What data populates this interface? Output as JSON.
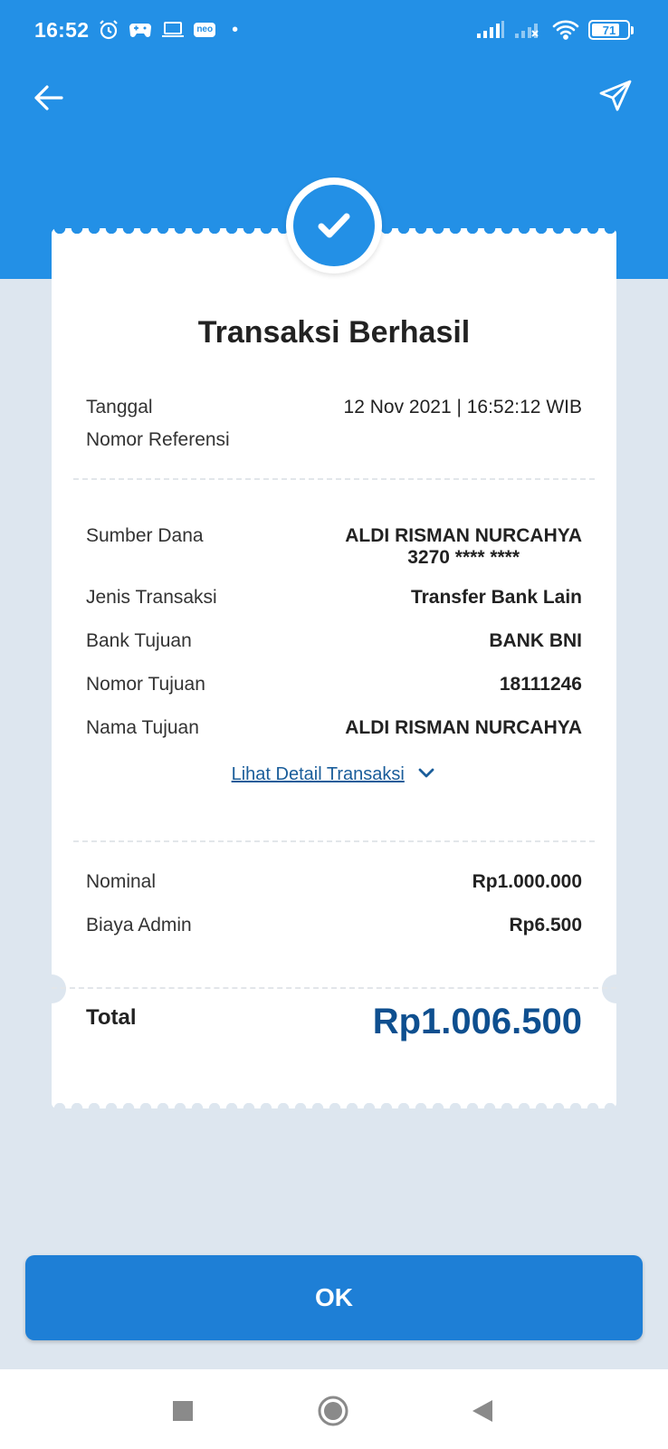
{
  "status_bar": {
    "time": "16:52",
    "neo_label": "neo",
    "battery": "71",
    "battery_level": 0.71,
    "icons": [
      "alarm-icon",
      "game-icon",
      "laptop-icon",
      "neo-icon",
      "signal-icon",
      "signal-x-icon",
      "wifi-icon",
      "battery-icon"
    ]
  },
  "header": {
    "back_icon": "arrow-left-icon",
    "share_icon": "send-icon"
  },
  "receipt": {
    "status_icon": "checkmark-icon",
    "title": "Transaksi Berhasil",
    "date_label": "Tanggal",
    "date_value": "12 Nov 2021 | 16:52:12 WIB",
    "reference_label": "Nomor Referensi",
    "reference_value": "",
    "source_label": "Sumber Dana",
    "source_name": "ALDI RISMAN NURCAHYA",
    "source_account": "3270 **** ****",
    "type_label": "Jenis Transaksi",
    "type_value": "Transfer Bank Lain",
    "bank_label": "Bank Tujuan",
    "bank_value": "BANK BNI",
    "dest_number_label": "Nomor Tujuan",
    "dest_number_value": "18111246",
    "dest_name_label": "Nama Tujuan",
    "dest_name_value": "ALDI RISMAN NURCAHYA",
    "detail_link": "Lihat Detail Transaksi",
    "nominal_label": "Nominal",
    "nominal_value": "Rp1.000.000",
    "admin_label": "Biaya Admin",
    "admin_value": "Rp6.500",
    "total_label": "Total",
    "total_value": "Rp1.006.500"
  },
  "ok_button": "OK",
  "colors": {
    "primary": "#2390e6",
    "button": "#1e7fd6",
    "total": "#0e4f8f",
    "background": "#dde6ef"
  }
}
